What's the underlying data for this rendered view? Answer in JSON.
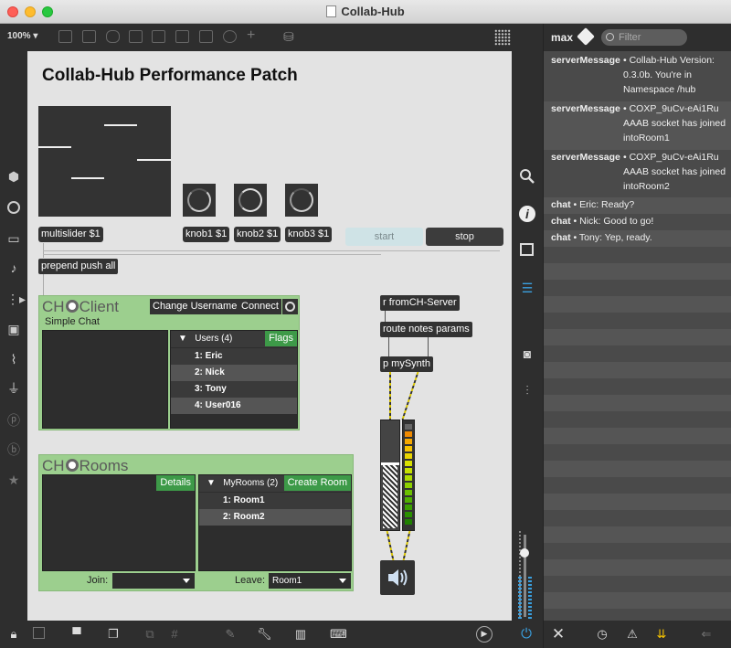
{
  "window": {
    "title": "Collab-Hub"
  },
  "toolbar": {
    "zoom": "100%"
  },
  "patch": {
    "title": "Collab-Hub Performance Patch",
    "multislider_msg": "multislider $1",
    "knob1_msg": "knob1 $1",
    "knob2_msg": "knob2 $1",
    "knob3_msg": "knob3 $1",
    "start_label": "start",
    "stop_label": "stop",
    "prepend_obj": "prepend push all",
    "r_obj": "r fromCH-Server",
    "route_obj": "route notes params",
    "synth_obj": "p mySynth"
  },
  "client_panel": {
    "logo_left": "CH",
    "logo_right": "Client",
    "change_username": "Change Username",
    "connect": "Connect",
    "simple_chat": "Simple Chat",
    "users_header": "Users (4)",
    "flags": "Flags",
    "users": [
      "1: Eric",
      "2: Nick",
      "3: Tony",
      "4: User016"
    ]
  },
  "rooms_panel": {
    "logo_left": "CH",
    "logo_right": "Rooms",
    "details": "Details",
    "myrooms_header": "MyRooms (2)",
    "create_room": "Create Room",
    "rooms": [
      "1: Room1",
      "2: Room2"
    ],
    "join_label": "Join:",
    "leave_label": "Leave:",
    "leave_value": "Room1"
  },
  "console": {
    "title": "max",
    "filter_placeholder": "Filter",
    "server_messages": [
      {
        "key": "serverMessage",
        "text": "• Collab-Hub Version: 0.3.0b. You're in Namespace /hub"
      },
      {
        "key": "serverMessage",
        "text": "• COXP_9uCv-eAi1Ru AAAB socket has joined intoRoom1"
      },
      {
        "key": "serverMessage",
        "text": "• COXP_9uCv-eAi1Ru AAAB socket has joined intoRoom2"
      }
    ],
    "chat": [
      {
        "key": "chat",
        "text": "• Eric: Ready?"
      },
      {
        "key": "chat",
        "text": "• Nick: Good to go!"
      },
      {
        "key": "chat",
        "text": "• Tony: Yep, ready."
      }
    ]
  },
  "colors": {
    "panel_green": "#9ccf8e",
    "accent_green": "#3d9a48",
    "canvas": "#e3e3e3",
    "console_bg": "#4a4a4a",
    "power_blue": "#3aa0e0"
  }
}
